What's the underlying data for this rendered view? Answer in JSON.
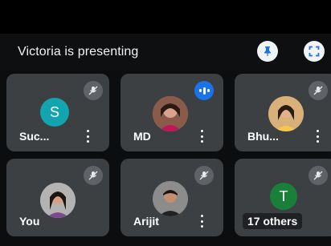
{
  "presentation_bar": {
    "text": "Victoria is presenting",
    "pin_icon": "pin-icon",
    "fullscreen_icon": "fullscreen-icon"
  },
  "participants": [
    {
      "name": "Suc...",
      "avatar_letter": "S",
      "avatar_color": "#12a4af",
      "mic": "muted"
    },
    {
      "name": "MD",
      "avatar_type": "photo",
      "mic": "speaking"
    },
    {
      "name": "Bhu...",
      "avatar_type": "photo",
      "mic": "muted"
    },
    {
      "name": "You",
      "avatar_type": "photo",
      "mic": "muted"
    },
    {
      "name": "Arijit",
      "avatar_type": "photo",
      "mic": "muted"
    },
    {
      "name": "17 others",
      "avatar_letter": "T",
      "avatar_color": "#188038",
      "mic": "muted"
    }
  ],
  "colors": {
    "tile_background": "#3c4043",
    "speaking_indicator": "#1a73e8",
    "background": "#0c0d0f"
  }
}
